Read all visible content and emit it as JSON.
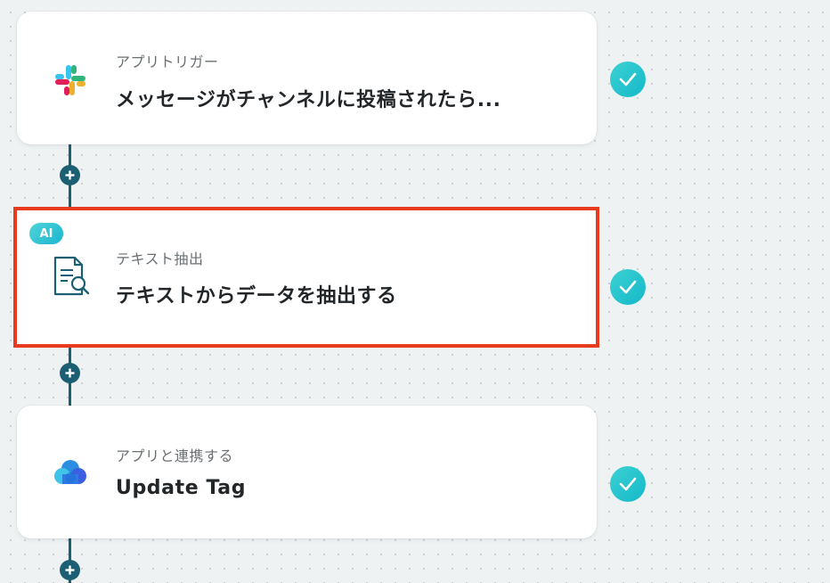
{
  "flow": {
    "steps": [
      {
        "subtitle": "アプリトリガー",
        "title": "メッセージがチャンネルに投稿されたら...",
        "icon": "slack-icon",
        "status": "completed"
      },
      {
        "badge": "AI",
        "subtitle": "テキスト抽出",
        "title": "テキストからデータを抽出する",
        "icon": "document-search-icon",
        "status": "completed",
        "selected": true
      },
      {
        "subtitle": "アプリと連携する",
        "title": "Update Tag",
        "icon": "cloud-app-icon",
        "status": "completed"
      }
    ]
  },
  "colors": {
    "connector": "#1d5f72",
    "check_gradient": [
      "#3cd1d3",
      "#14b9c9"
    ],
    "selection_outline": "#e83a1f",
    "background": "#eef2f3"
  }
}
